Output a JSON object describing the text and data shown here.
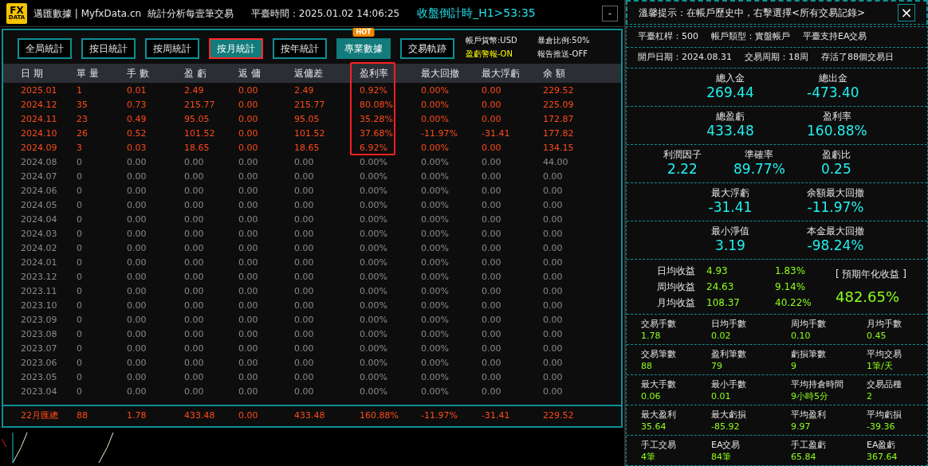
{
  "title_bar": {
    "logo_top": "FX",
    "logo_bottom": "DATA",
    "title": "邁匯數據 | MyfxData.cn  統計分析每壹筆交易",
    "server_time": "平臺時間：2025.01.02 14:06:25",
    "countdown": "收盤倒計時_H1>53:35",
    "minimize": "-"
  },
  "tabs": [
    {
      "label": "全局統計",
      "selected": false,
      "kind": "normal"
    },
    {
      "label": "按日統計",
      "selected": false,
      "kind": "normal"
    },
    {
      "label": "按周統計",
      "selected": false,
      "kind": "normal"
    },
    {
      "label": "按月統計",
      "selected": true,
      "kind": "normal"
    },
    {
      "label": "按年統計",
      "selected": false,
      "kind": "normal"
    },
    {
      "label": "專業數據",
      "selected": false,
      "kind": "accent",
      "badge": "HOT"
    },
    {
      "label": "交易軌跡",
      "selected": false,
      "kind": "normal"
    }
  ],
  "account_info": [
    {
      "text": "帳戶貨幣:USD",
      "kind": "plain"
    },
    {
      "text": "暴倉比例:50%",
      "kind": "plain"
    },
    {
      "text": "盈虧警報-ON",
      "kind": "warning"
    },
    {
      "text": "報告推送-OFF",
      "kind": "plain"
    }
  ],
  "table": {
    "columns": [
      {
        "label": "日 期",
        "outlined": false
      },
      {
        "label": "單 量",
        "outlined": false
      },
      {
        "label": "手 數",
        "outlined": false
      },
      {
        "label": "盈 虧",
        "outlined": false
      },
      {
        "label": "返 傭",
        "outlined": false
      },
      {
        "label": "返傭差",
        "outlined": false
      },
      {
        "label": "盈利率",
        "outlined": true
      },
      {
        "label": "最大回撤",
        "outlined": false
      },
      {
        "label": "最大浮虧",
        "outlined": false
      },
      {
        "label": "余 額",
        "outlined": false
      }
    ],
    "rows": [
      {
        "active": true,
        "cells": [
          "2025.01",
          "1",
          "0.01",
          "2.49",
          "0.00",
          "2.49",
          "0.92%",
          "0.00%",
          "0.00",
          "229.52"
        ]
      },
      {
        "active": true,
        "cells": [
          "2024.12",
          "35",
          "0.73",
          "215.77",
          "0.00",
          "215.77",
          "80.08%",
          "0.00%",
          "0.00",
          "225.09"
        ]
      },
      {
        "active": true,
        "cells": [
          "2024.11",
          "23",
          "0.49",
          "95.05",
          "0.00",
          "95.05",
          "35.28%",
          "0.00%",
          "0.00",
          "172.87"
        ]
      },
      {
        "active": true,
        "cells": [
          "2024.10",
          "26",
          "0.52",
          "101.52",
          "0.00",
          "101.52",
          "37.68%",
          "-11.97%",
          "-31.41",
          "177.82"
        ]
      },
      {
        "active": true,
        "cells": [
          "2024.09",
          "3",
          "0.03",
          "18.65",
          "0.00",
          "18.65",
          "6.92%",
          "0.00%",
          "0.00",
          "134.15"
        ]
      },
      {
        "active": false,
        "cells": [
          "2024.08",
          "0",
          "0.00",
          "0.00",
          "0.00",
          "0.00",
          "0.00%",
          "0.00%",
          "0.00",
          "44.00"
        ]
      },
      {
        "active": false,
        "cells": [
          "2024.07",
          "0",
          "0.00",
          "0.00",
          "0.00",
          "0.00",
          "0.00%",
          "0.00%",
          "0.00",
          "0.00"
        ]
      },
      {
        "active": false,
        "cells": [
          "2024.06",
          "0",
          "0.00",
          "0.00",
          "0.00",
          "0.00",
          "0.00%",
          "0.00%",
          "0.00",
          "0.00"
        ]
      },
      {
        "active": false,
        "cells": [
          "2024.05",
          "0",
          "0.00",
          "0.00",
          "0.00",
          "0.00",
          "0.00%",
          "0.00%",
          "0.00",
          "0.00"
        ]
      },
      {
        "active": false,
        "cells": [
          "2024.04",
          "0",
          "0.00",
          "0.00",
          "0.00",
          "0.00",
          "0.00%",
          "0.00%",
          "0.00",
          "0.00"
        ]
      },
      {
        "active": false,
        "cells": [
          "2024.03",
          "0",
          "0.00",
          "0.00",
          "0.00",
          "0.00",
          "0.00%",
          "0.00%",
          "0.00",
          "0.00"
        ]
      },
      {
        "active": false,
        "cells": [
          "2024.02",
          "0",
          "0.00",
          "0.00",
          "0.00",
          "0.00",
          "0.00%",
          "0.00%",
          "0.00",
          "0.00"
        ]
      },
      {
        "active": false,
        "cells": [
          "2024.01",
          "0",
          "0.00",
          "0.00",
          "0.00",
          "0.00",
          "0.00%",
          "0.00%",
          "0.00",
          "0.00"
        ]
      },
      {
        "active": false,
        "cells": [
          "2023.12",
          "0",
          "0.00",
          "0.00",
          "0.00",
          "0.00",
          "0.00%",
          "0.00%",
          "0.00",
          "0.00"
        ]
      },
      {
        "active": false,
        "cells": [
          "2023.11",
          "0",
          "0.00",
          "0.00",
          "0.00",
          "0.00",
          "0.00%",
          "0.00%",
          "0.00",
          "0.00"
        ]
      },
      {
        "active": false,
        "cells": [
          "2023.10",
          "0",
          "0.00",
          "0.00",
          "0.00",
          "0.00",
          "0.00%",
          "0.00%",
          "0.00",
          "0.00"
        ]
      },
      {
        "active": false,
        "cells": [
          "2023.09",
          "0",
          "0.00",
          "0.00",
          "0.00",
          "0.00",
          "0.00%",
          "0.00%",
          "0.00",
          "0.00"
        ]
      },
      {
        "active": false,
        "cells": [
          "2023.08",
          "0",
          "0.00",
          "0.00",
          "0.00",
          "0.00",
          "0.00%",
          "0.00%",
          "0.00",
          "0.00"
        ]
      },
      {
        "active": false,
        "cells": [
          "2023.07",
          "0",
          "0.00",
          "0.00",
          "0.00",
          "0.00",
          "0.00%",
          "0.00%",
          "0.00",
          "0.00"
        ]
      },
      {
        "active": false,
        "cells": [
          "2023.06",
          "0",
          "0.00",
          "0.00",
          "0.00",
          "0.00",
          "0.00%",
          "0.00%",
          "0.00",
          "0.00"
        ]
      },
      {
        "active": false,
        "cells": [
          "2023.05",
          "0",
          "0.00",
          "0.00",
          "0.00",
          "0.00",
          "0.00%",
          "0.00%",
          "0.00",
          "0.00"
        ]
      },
      {
        "active": false,
        "cells": [
          "2023.04",
          "0",
          "0.00",
          "0.00",
          "0.00",
          "0.00",
          "0.00%",
          "0.00%",
          "0.00",
          "0.00"
        ]
      }
    ],
    "total": [
      "22月匯總",
      "88",
      "1.78",
      "433.48",
      "0.00",
      "433.48",
      "160.88%",
      "-11.97%",
      "-31.41",
      "229.52"
    ]
  },
  "side_panel": {
    "tip": "溫馨提示：在帳戶歷史中，右擊選擇<所有交易記錄>",
    "close": "×",
    "info_lines": [
      [
        "平臺杠桿：500",
        "帳戶類型：實盤帳戶",
        "平臺支持EA交易"
      ],
      [
        "開戶日期：2024.08.31",
        "交易周期：18周",
        "存活了88個交易日"
      ]
    ],
    "big_stats": [
      [
        {
          "label": "總入金",
          "value": "269.44"
        },
        {
          "label": "總出金",
          "value": "-473.40"
        }
      ],
      [
        {
          "label": "總盈虧",
          "value": "433.48"
        },
        {
          "label": "盈利率",
          "value": "160.88%"
        }
      ],
      [
        {
          "label": "利潤因子",
          "value": "2.22"
        },
        {
          "label": "準確率",
          "value": "89.77%"
        },
        {
          "label": "盈虧比",
          "value": "0.25"
        }
      ],
      [
        {
          "label": "最大浮虧",
          "value": "-31.41"
        },
        {
          "label": "余額最大回撤",
          "value": "-11.97%"
        }
      ],
      [
        {
          "label": "最小淨值",
          "value": "3.19"
        },
        {
          "label": "本金最大回撤",
          "value": "-98.24%"
        }
      ]
    ],
    "earnings": [
      {
        "label": "日均收益",
        "amount": "4.93",
        "percent": "1.83%"
      },
      {
        "label": "周均收益",
        "amount": "24.63",
        "percent": "9.14%"
      },
      {
        "label": "月均收益",
        "amount": "108.37",
        "percent": "40.22%"
      }
    ],
    "annual": {
      "label": "[ 預期年化收益 ]",
      "value": "482.65%"
    },
    "grid": [
      [
        {
          "label": "交易手數",
          "value": "1.78"
        },
        {
          "label": "日均手數",
          "value": "0.02"
        },
        {
          "label": "周均手數",
          "value": "0.10"
        },
        {
          "label": "月均手數",
          "value": "0.45"
        }
      ],
      [
        {
          "label": "交易筆數",
          "value": "88"
        },
        {
          "label": "盈利筆數",
          "value": "79"
        },
        {
          "label": "虧損筆數",
          "value": "9"
        },
        {
          "label": "平均交易",
          "value": "1筆/天"
        }
      ],
      [
        {
          "label": "最大手數",
          "value": "0.06"
        },
        {
          "label": "最小手數",
          "value": "0.01"
        },
        {
          "label": "平均持倉時間",
          "value": "9小時5分"
        },
        {
          "label": "交易品種",
          "value": "2"
        }
      ],
      [
        {
          "label": "最大盈利",
          "value": "35.64"
        },
        {
          "label": "最大虧損",
          "value": "-85.92"
        },
        {
          "label": "平均盈利",
          "value": "9.97"
        },
        {
          "label": "平均虧損",
          "value": "-39.36"
        }
      ],
      [
        {
          "label": "手工交易",
          "value": "4筆"
        },
        {
          "label": "EA交易",
          "value": "84筆"
        },
        {
          "label": "手工盈虧",
          "value": "65.84"
        },
        {
          "label": "EA盈虧",
          "value": "367.64"
        }
      ]
    ]
  }
}
